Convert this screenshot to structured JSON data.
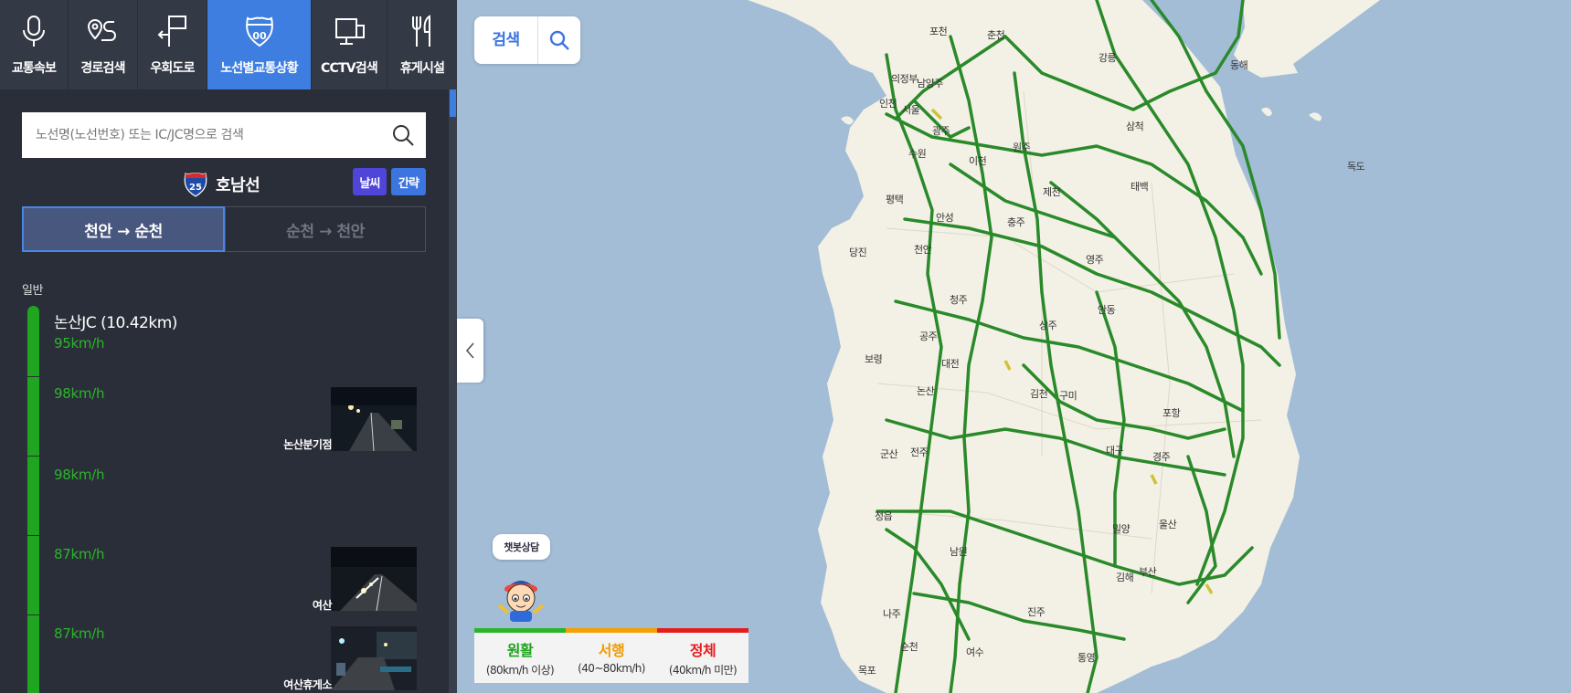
{
  "nav": [
    {
      "label": "교통속보",
      "icon": "microphone-icon"
    },
    {
      "label": "경로검색",
      "icon": "route-icon"
    },
    {
      "label": "우회도로",
      "icon": "detour-sign-icon"
    },
    {
      "label": "노선별교통상황",
      "icon": "highway-shield-icon"
    },
    {
      "label": "CCTV검색",
      "icon": "monitor-icon"
    },
    {
      "label": "휴게시설",
      "icon": "fork-knife-icon"
    }
  ],
  "nav_active_index": 3,
  "search": {
    "placeholder": "노선명(노선번호) 또는 IC/JC명으로 검색"
  },
  "route": {
    "number": "25",
    "name": "호남선",
    "weather_label": "날씨",
    "brief_label": "간략"
  },
  "directions": [
    {
      "label": "천안 → 순천",
      "active": true
    },
    {
      "label": "순천 → 천안",
      "active": false
    }
  ],
  "section_label": "일반",
  "segments": [
    {
      "name": "논산JC (10.42km)",
      "speed": "95km/h"
    },
    {
      "speed": "98km/h",
      "cctv_label": "논산분기점"
    },
    {
      "speed": "98km/h"
    },
    {
      "speed": "87km/h",
      "cctv_label": "여산"
    },
    {
      "speed": "87km/h",
      "cctv_label": "여산휴게소"
    }
  ],
  "map": {
    "search_label": "검색",
    "chatbot_label": "챗봇상담",
    "legend": [
      {
        "title": "원활",
        "range": "(80km/h 이상)",
        "color": "#2bb52b"
      },
      {
        "title": "서행",
        "range": "(40~80km/h)",
        "color": "#f4a000"
      },
      {
        "title": "정체",
        "range": "(40km/h 미만)",
        "color": "#e51d1d"
      }
    ],
    "cities": [
      "포천",
      "춘천",
      "강릉",
      "동해",
      "삼척",
      "태백",
      "독도",
      "의정부",
      "남양주",
      "인천",
      "서울",
      "광주",
      "수원",
      "이천",
      "원주",
      "제천",
      "평택",
      "안성",
      "충주",
      "천안",
      "당진",
      "영주",
      "청주",
      "안동",
      "공주",
      "상주",
      "보령",
      "대전",
      "논산",
      "김천",
      "구미",
      "포항",
      "군산",
      "전주",
      "대구",
      "경주",
      "정읍",
      "밀양",
      "울산",
      "남원",
      "김해",
      "부산",
      "나주",
      "진주",
      "순천",
      "여수",
      "통영",
      "목포"
    ]
  }
}
